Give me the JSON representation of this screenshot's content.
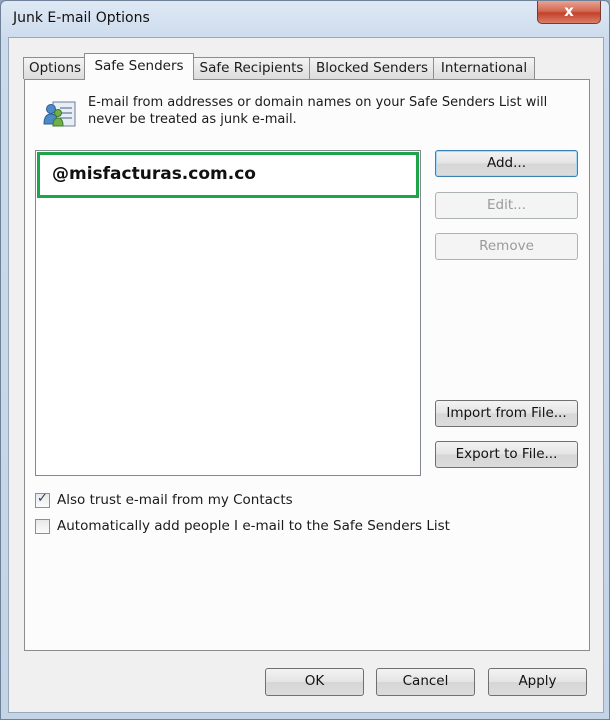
{
  "window": {
    "title": "Junk E-mail Options",
    "close_label": "x"
  },
  "tabs": [
    {
      "label": "Options"
    },
    {
      "label": "Safe Senders"
    },
    {
      "label": "Safe Recipients"
    },
    {
      "label": "Blocked Senders"
    },
    {
      "label": "International"
    }
  ],
  "active_tab": "Safe Senders",
  "description": "E-mail from addresses or domain names on your Safe Senders List will never be treated as junk e-mail.",
  "safe_senders": [
    "@misfacturas.com.co"
  ],
  "buttons": {
    "add": "Add...",
    "edit": "Edit...",
    "remove": "Remove",
    "import": "Import from File...",
    "export": "Export to File..."
  },
  "options": [
    {
      "label": "Also trust e-mail from my Contacts",
      "checked": true
    },
    {
      "label": "Automatically add people I e-mail to the Safe Senders List",
      "checked": false
    }
  ],
  "footer": {
    "ok": "OK",
    "cancel": "Cancel",
    "apply": "Apply"
  },
  "colors": {
    "highlight_border": "#1ea44a",
    "close_button": "#c4412a"
  }
}
